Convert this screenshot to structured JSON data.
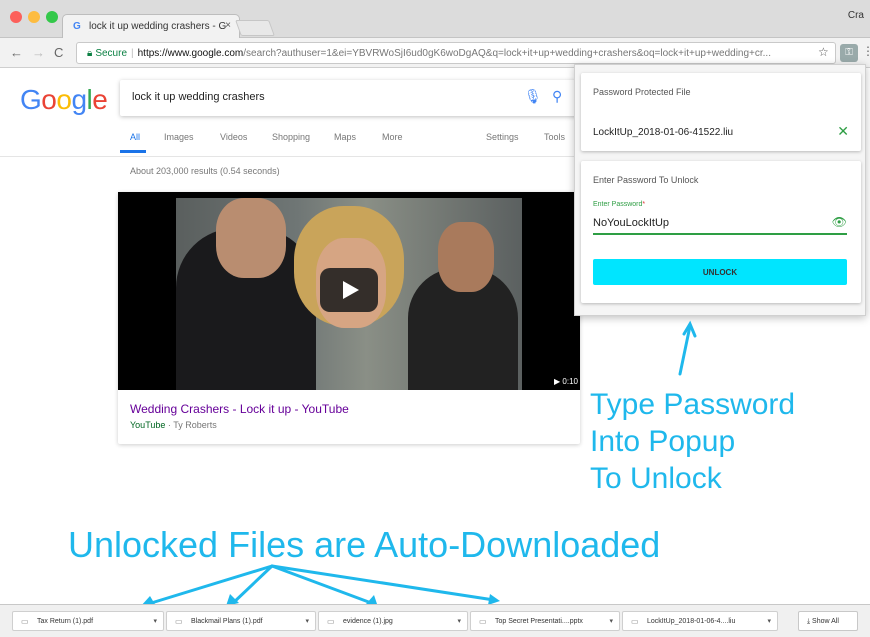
{
  "browser": {
    "tab_title": "lock it up wedding crashers - G",
    "tab_close": "×",
    "corner_text": "Cra",
    "url_secure": "Secure",
    "url_domain": "https://www.google.com",
    "url_rest": "/search?authuser=1&ei=YBVRWoSjI6ud0gK6woDgAQ&q=lock+it+up+wedding+crashers&oq=lock+it+up+wedding+cr..."
  },
  "google": {
    "logo": [
      "G",
      "o",
      "o",
      "g",
      "l",
      "e"
    ],
    "logo_colors": [
      "#4285F4",
      "#EA4335",
      "#FBBC05",
      "#4285F4",
      "#34A853",
      "#EA4335"
    ],
    "query": "lock it up wedding crashers",
    "tabs": [
      "All",
      "Images",
      "Videos",
      "Shopping",
      "Maps",
      "More"
    ],
    "settings": "Settings",
    "tools": "Tools",
    "results_count": "About 203,000 results (0.54 seconds)",
    "video": {
      "duration": "▶ 0:10",
      "title": "Wedding Crashers - Lock it up - YouTube",
      "source": "YouTube",
      "author": " · Ty Roberts"
    }
  },
  "popup": {
    "card1_title": "Password Protected File",
    "file_name": "LockItUp_2018-01-06-41522.liu",
    "card2_title": "Enter Password To Unlock",
    "field_label": "Enter Password",
    "password_value": "NoYouLockItUp",
    "unlock_label": "UNLOCK"
  },
  "annotations": {
    "popup_note_line1": "Type Password",
    "popup_note_line2": "Into Popup",
    "popup_note_line3": "To Unlock",
    "downloads_note": "Unlocked Files are Auto-Downloaded",
    "color": "#1fb8ec"
  },
  "downloads": {
    "items": [
      "Tax Return (1).pdf",
      "Blackmail Plans (1).pdf",
      "evidence (1).jpg",
      "Top Secret Presentati....pptx",
      "LockItUp_2018-01-06-4....liu"
    ],
    "show_all": "Show All"
  }
}
